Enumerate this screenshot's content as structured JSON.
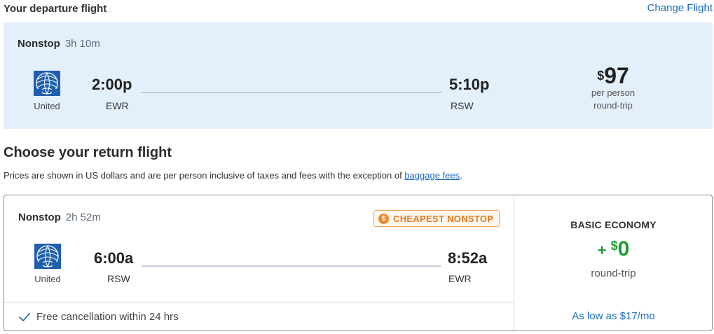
{
  "departure": {
    "heading": "Your departure flight",
    "change_label": "Change Flight",
    "stops": "Nonstop",
    "duration": "3h 10m",
    "airline": "United",
    "depart_time": "2:00p",
    "depart_code": "EWR",
    "arrive_time": "5:10p",
    "arrive_code": "RSW",
    "price_symbol": "$",
    "price_value": "97",
    "price_note_1": "per person",
    "price_note_2": "round-trip"
  },
  "return_section": {
    "heading": "Choose your return flight",
    "disclaimer_text": "Prices are shown in US dollars and are per person inclusive of taxes and fees with the exception of ",
    "disclaimer_link": "baggage fees",
    "disclaimer_end": "."
  },
  "return_flight": {
    "stops": "Nonstop",
    "duration": "2h 52m",
    "badge_icon": "$",
    "badge": "CHEAPEST NONSTOP",
    "airline": "United",
    "depart_time": "6:00a",
    "depart_code": "RSW",
    "arrive_time": "8:52a",
    "arrive_code": "EWR",
    "cancellation": "Free cancellation within 24 hrs",
    "fare_class": "BASIC ECONOMY",
    "fare_plus": "+",
    "fare_symbol": "$",
    "fare_value": "0",
    "fare_note": "round-trip",
    "financing": "As low as $17/mo"
  },
  "colors": {
    "accent_blue": "#1a6bbf",
    "departure_bg": "#e4effc",
    "badge_orange": "#e27a1f",
    "fare_green": "#1e9e2f",
    "united_blue": "#1f5fae"
  },
  "icons": {
    "airline_logo": "united-globe-icon",
    "badge": "dollar-coin-icon",
    "cancel": "checkmark-icon"
  }
}
